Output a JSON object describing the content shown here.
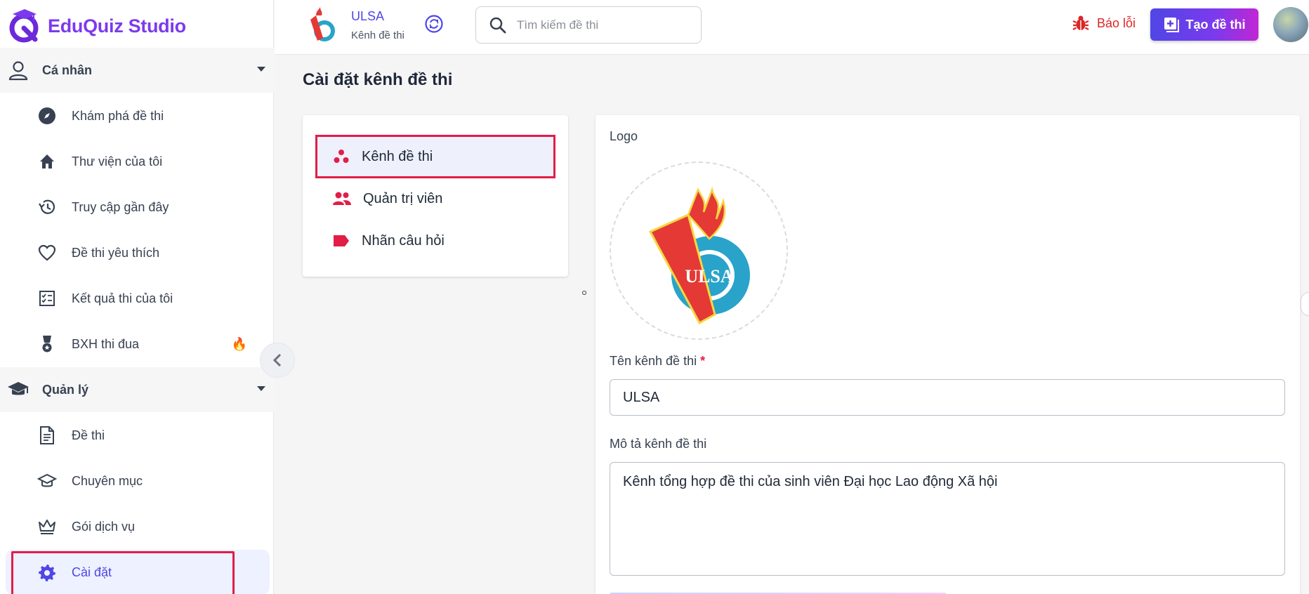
{
  "brand": {
    "name": "EduQuiz Studio"
  },
  "sidebar": {
    "personal": {
      "label": "Cá nhân",
      "items": [
        {
          "label": "Khám phá đề thi",
          "icon": "compass-icon"
        },
        {
          "label": "Thư viện của tôi",
          "icon": "home-icon"
        },
        {
          "label": "Truy cập gần đây",
          "icon": "history-icon"
        },
        {
          "label": "Đề thi yêu thích",
          "icon": "heart-icon"
        },
        {
          "label": "Kết quả thi của tôi",
          "icon": "checklist-icon"
        },
        {
          "label": "BXH thi đua",
          "icon": "medal-icon",
          "badge": "🔥"
        }
      ]
    },
    "manage": {
      "label": "Quản lý",
      "items": [
        {
          "label": "Đề thi",
          "icon": "document-icon"
        },
        {
          "label": "Chuyên mục",
          "icon": "graduation-cap-icon"
        },
        {
          "label": "Gói dịch vụ",
          "icon": "crown-icon"
        },
        {
          "label": "Cài đặt",
          "icon": "gear-icon",
          "active": true
        }
      ]
    }
  },
  "topbar": {
    "channel_name": "ULSA",
    "channel_sub": "Kênh đề thi",
    "search_placeholder": "Tìm kiếm đề thi",
    "report_label": "Báo lỗi",
    "create_label": "Tạo đề thi"
  },
  "page": {
    "title": "Cài đặt kênh đề thi",
    "menu": [
      {
        "label": "Kênh đề thi",
        "icon": "group-dots-icon",
        "active": true
      },
      {
        "label": "Quản trị viên",
        "icon": "people-icon"
      },
      {
        "label": "Nhãn câu hỏi",
        "icon": "label-tag-icon"
      }
    ],
    "form": {
      "logo_label": "Logo",
      "logo_text": "ULSA",
      "name_label": "Tên kênh đề thi",
      "name_required": "*",
      "name_value": "ULSA",
      "desc_label": "Mô tả kênh đề thi",
      "desc_value": "Kênh tổng hợp đề thi của sinh viên Đại học Lao động Xã hội"
    }
  },
  "colors": {
    "accent": "#4f46e5",
    "brand": "#7c3aed",
    "highlight": "#e11d48",
    "report": "#dc2626",
    "menu_icon": "#e11d48"
  }
}
